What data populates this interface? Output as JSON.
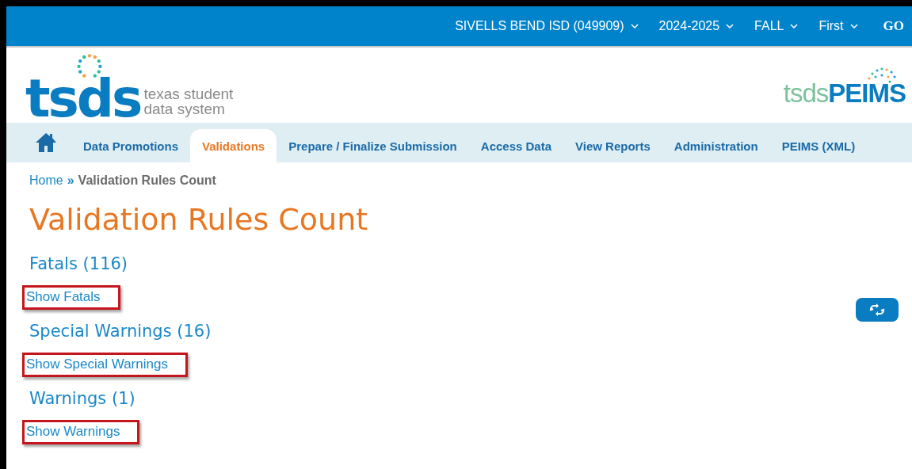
{
  "top_bar": {
    "selectors": [
      {
        "label": "SIVELLS BEND ISD (049909)"
      },
      {
        "label": "2024-2025"
      },
      {
        "label": "FALL"
      },
      {
        "label": "First"
      }
    ],
    "go_button": "GO"
  },
  "header": {
    "logo_mark": "tsds",
    "logo_tagline": [
      "texas student",
      "data system"
    ],
    "product_logo": {
      "prefix": "tsds",
      "name": "PEIMS"
    }
  },
  "nav": {
    "tabs": [
      {
        "label": "Data Promotions",
        "selected": false
      },
      {
        "label": "Validations",
        "selected": true
      },
      {
        "label": "Prepare / Finalize Submission",
        "selected": false
      },
      {
        "label": "Access Data",
        "selected": false
      },
      {
        "label": "View Reports",
        "selected": false
      },
      {
        "label": "Administration",
        "selected": false
      },
      {
        "label": "PEIMS (XML)",
        "selected": false
      }
    ]
  },
  "breadcrumb": {
    "home": "Home",
    "separator": "»",
    "current": "Validation Rules Count"
  },
  "title": "Validation Rules Count",
  "sections": [
    {
      "heading": "Fatals (116)",
      "link": "Show Fatals",
      "highlighted": true
    },
    {
      "heading": "Special Warnings (16)",
      "link": "Show Special Warnings",
      "highlighted": true
    },
    {
      "heading": "Warnings (1)",
      "link": "Show Warnings",
      "highlighted": true
    }
  ]
}
